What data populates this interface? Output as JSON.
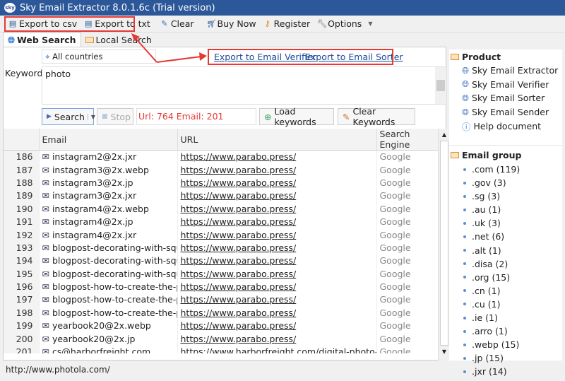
{
  "window": {
    "title": "Sky Email Extractor 8.0.1.6c (Trial version)",
    "logo": "sky"
  },
  "toolbar": {
    "export_csv": "Export to csv",
    "export_txt": "Export to txt",
    "clear": "Clear",
    "buy_now": "Buy Now",
    "register": "Register",
    "options": "Options"
  },
  "tabs": [
    {
      "label": "Web Search"
    },
    {
      "label": "Local Search"
    }
  ],
  "search": {
    "country": "All countries",
    "keyword_label": "Keyword:",
    "keyword": "photo",
    "export_verifier": "Export to Email Verifier",
    "export_sorter": "Export to Email Sorter",
    "search_btn": "Search",
    "stop_btn": "Stop",
    "stats": "Url: 764 Email: 201",
    "load_keywords": "Load keywords",
    "clear_keywords": "Clear Keywords"
  },
  "table": {
    "headers": [
      "Email",
      "URL",
      "Search Engine"
    ],
    "rows": [
      [
        "186",
        "instagram2@2x.jxr",
        "https://www.parabo.press/",
        "Google"
      ],
      [
        "187",
        "instagram3@2x.webp",
        "https://www.parabo.press/",
        "Google"
      ],
      [
        "188",
        "instagram3@2x.jp",
        "https://www.parabo.press/",
        "Google"
      ],
      [
        "189",
        "instagram3@2x.jxr",
        "https://www.parabo.press/",
        "Google"
      ],
      [
        "190",
        "instagram4@2x.webp",
        "https://www.parabo.press/",
        "Google"
      ],
      [
        "191",
        "instagram4@2x.jp",
        "https://www.parabo.press/",
        "Google"
      ],
      [
        "192",
        "instagram4@2x.jxr",
        "https://www.parabo.press/",
        "Google"
      ],
      [
        "193",
        "blogpost-decorating-with-squa...",
        "https://www.parabo.press/",
        "Google"
      ],
      [
        "194",
        "blogpost-decorating-with-squa...",
        "https://www.parabo.press/",
        "Google"
      ],
      [
        "195",
        "blogpost-decorating-with-squa...",
        "https://www.parabo.press/",
        "Google"
      ],
      [
        "196",
        "blogpost-how-to-create-the-pe...",
        "https://www.parabo.press/",
        "Google"
      ],
      [
        "197",
        "blogpost-how-to-create-the-pe...",
        "https://www.parabo.press/",
        "Google"
      ],
      [
        "198",
        "blogpost-how-to-create-the-pe...",
        "https://www.parabo.press/",
        "Google"
      ],
      [
        "199",
        "yearbook20@2x.webp",
        "https://www.parabo.press/",
        "Google"
      ],
      [
        "200",
        "yearbook20@2x.jp",
        "https://www.parabo.press/",
        "Google"
      ],
      [
        "201",
        "cs@harborfreight.com",
        "https://www.harborfreight.com/digital-photo-sen...",
        "Google"
      ]
    ]
  },
  "product": {
    "title": "Product",
    "items": [
      "Sky Email Extractor",
      "Sky Email Verifier",
      "Sky Email Sorter",
      "Sky Email Sender",
      "Help document"
    ]
  },
  "email_group": {
    "title": "Email group",
    "items": [
      ".com (119)",
      ".gov (3)",
      ".sg (3)",
      ".au (1)",
      ".uk (3)",
      ".net (6)",
      ".alt (1)",
      ".disa (2)",
      ".org (15)",
      ".cn (1)",
      ".cu (1)",
      ".ie (1)",
      ".arro (1)",
      ".webp (15)",
      ".jp (15)",
      ".jxr (14)"
    ]
  },
  "status": {
    "url": "http://www.photola.com/"
  },
  "colors": {
    "titlebar": "#2c5799",
    "annotation": "#e53935",
    "stats": "#e53935"
  }
}
